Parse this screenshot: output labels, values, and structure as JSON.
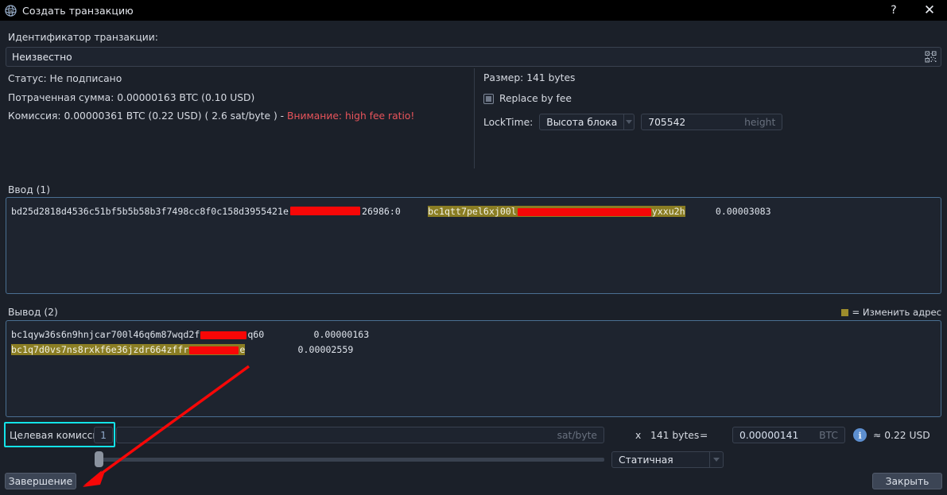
{
  "window": {
    "title": "Создать транзакцию",
    "app_icon": "bitcoin-logo-icon",
    "help_label": "?",
    "close_label": "✕"
  },
  "txid": {
    "label": "Идентификатор транзакции:",
    "value": "Неизвестно",
    "qr_icon": "qr-code-icon"
  },
  "status": {
    "status_line": "Статус: Не подписано",
    "spent_line": "Потраченная сумма: 0.00000163 BTC (0.10 USD)",
    "fee_line": "Комиссия: 0.00000361 BTC (0.22 USD) ( 2.6 sat/byte ) - ",
    "fee_warning": "Внимание: high fee ratio!"
  },
  "details": {
    "size_line": "Размер: 141 bytes",
    "rbf_label": "Replace by fee",
    "locktime_label": "LockTime:",
    "locktime_mode": "Высота блока",
    "locktime_value": "705542",
    "locktime_placeholder": "height"
  },
  "inputs": {
    "section_label": "Ввод (1)",
    "rows": [
      {
        "txid_prefix": "bd25d2818d4536c51bf5b5b58b3f7498cc8f0c158d3955421e",
        "txid_suffix": "26986:0",
        "address_prefix": "bc1qtt7pel6xj00l",
        "address_suffix": "yxxu2h",
        "amount": "0.00003083"
      }
    ]
  },
  "outputs": {
    "section_label": "Вывод (2)",
    "legend_text": "= Изменить адрес",
    "rows": [
      {
        "address_prefix": "bc1qyw36s6n9hnjcar700l46q6m87wqd2f",
        "address_suffix": "q60",
        "amount": "0.00000163",
        "is_change": false
      },
      {
        "address_prefix": "bc1q7d0vs7ns8rxkf6e36jzdr664zffr",
        "address_suffix": "e",
        "amount": "0.00002559",
        "is_change": true
      }
    ]
  },
  "fee_bar": {
    "target_fee_label": "Целевая комиссия:",
    "target_fee_value": "1",
    "rate_placeholder": "sat/byte",
    "multiply_symbol": "x",
    "size_text": "141 bytes",
    "equals_symbol": "=",
    "total_btc": "0.00000141",
    "btc_unit": "BTC",
    "info_icon": "info-icon",
    "usd_text": "≈ 0.22 USD",
    "fee_mode": "Статичная"
  },
  "buttons": {
    "finish_label": "Завершение",
    "close_label": "Закрыть"
  },
  "colors": {
    "highlight_change": "#8a7d23",
    "warning": "#e8545b",
    "accent_border": "#4a6f92",
    "annotation": "#f70707",
    "focus_box": "#13e3e8"
  }
}
